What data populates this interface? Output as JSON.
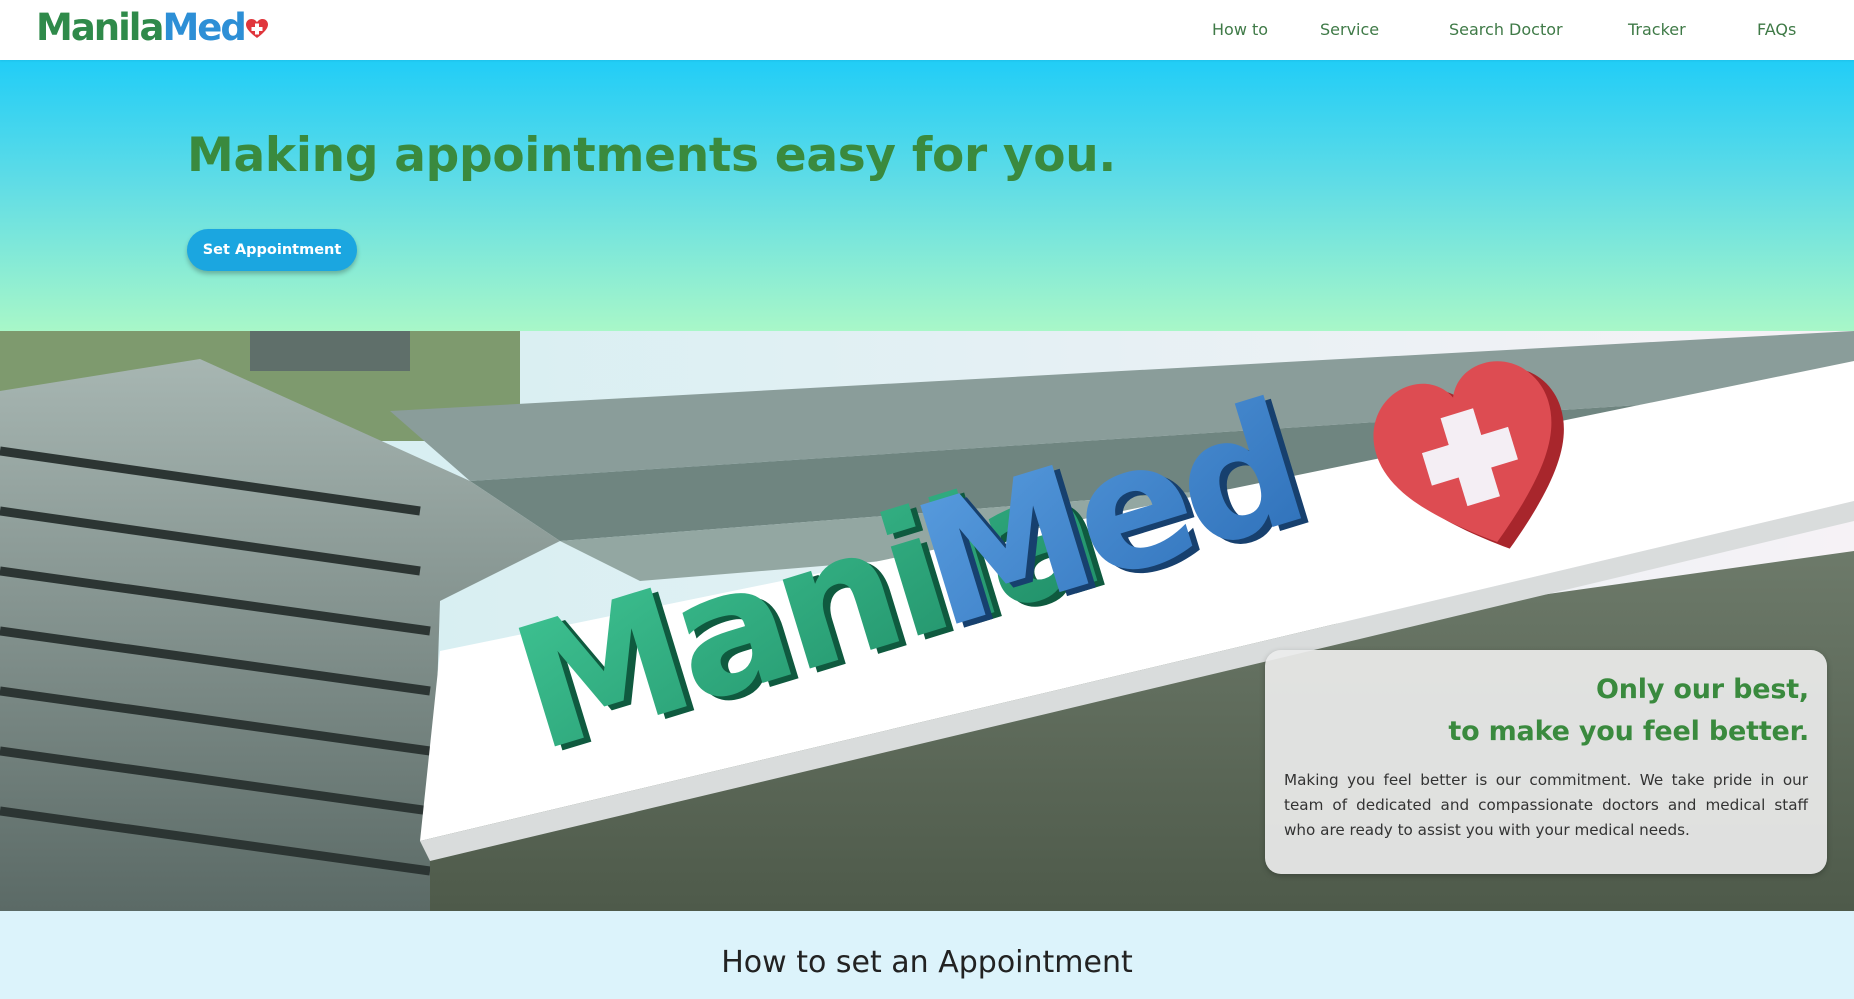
{
  "brand": {
    "name_part1": "Manila",
    "name_part2": "Med",
    "icon": "heart-cross-icon"
  },
  "nav": {
    "items": [
      {
        "label": "How to"
      },
      {
        "label": "Service"
      },
      {
        "label": "Search Doctor"
      },
      {
        "label": "Tracker"
      },
      {
        "label": "FAQs"
      }
    ]
  },
  "hero": {
    "title": "Making appointments easy for you.",
    "button_label": "Set Appointment"
  },
  "banner": {
    "sign_text_part1": "Manila",
    "sign_text_part2": "Med"
  },
  "card": {
    "heading_line1": "Only our best,",
    "heading_line2": "to make you feel better.",
    "body": "Making you feel better is our commitment. We take pride in our team of dedicated and compassionate doctors and medical staff who are ready to assist you with your medical needs."
  },
  "howto": {
    "title": "How to set an Appointment"
  },
  "colors": {
    "brand_green": "#3a8a3e",
    "brand_blue": "#2d8fd6",
    "button_blue": "#1ba6e0",
    "heart_red": "#e0363c",
    "hero_top": "#21cdf7",
    "hero_bottom": "#a8f7c8",
    "howto_bg": "#dcf3fb"
  }
}
